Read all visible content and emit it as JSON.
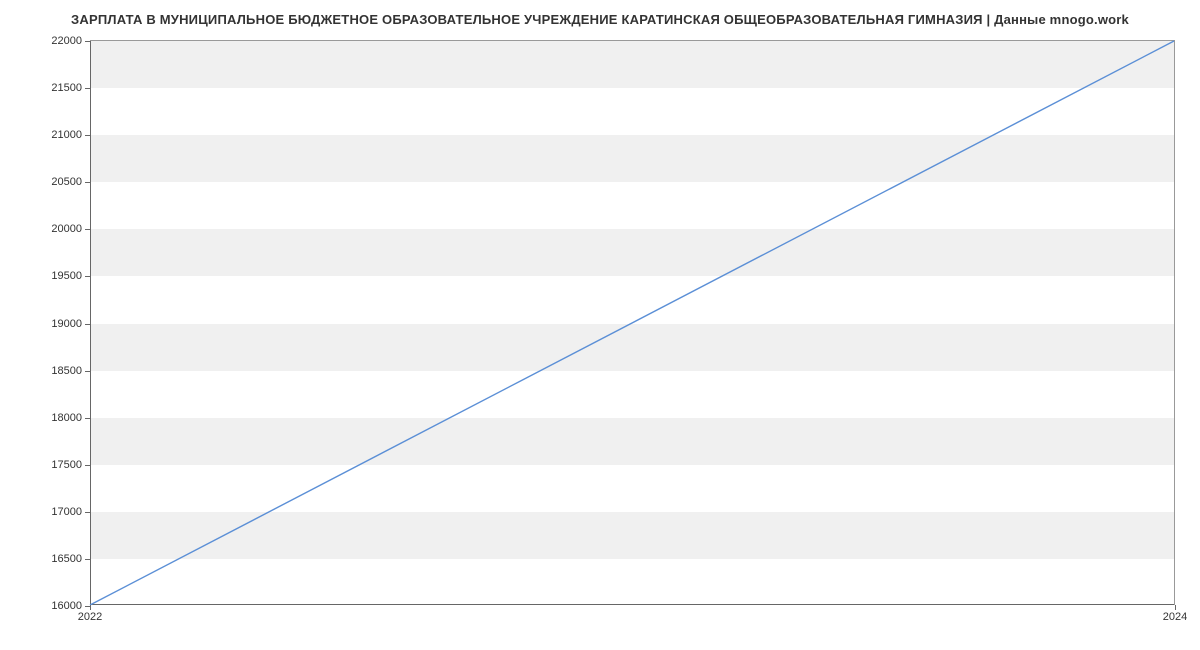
{
  "chart_data": {
    "type": "line",
    "title": "ЗАРПЛАТА В МУНИЦИПАЛЬНОЕ БЮДЖЕТНОЕ ОБРАЗОВАТЕЛЬНОЕ УЧРЕЖДЕНИЕ КАРАТИНСКАЯ ОБЩЕОБРАЗОВАТЕЛЬНАЯ ГИМНАЗИЯ | Данные mnogo.work",
    "x": [
      2022,
      2024
    ],
    "values": [
      16000,
      22000
    ],
    "xlabel": "",
    "ylabel": "",
    "xlim": [
      2022,
      2024
    ],
    "ylim": [
      16000,
      22000
    ],
    "x_ticks": [
      2022,
      2024
    ],
    "y_ticks": [
      16000,
      16500,
      17000,
      17500,
      18000,
      18500,
      19000,
      19500,
      20000,
      20500,
      21000,
      21500,
      22000
    ],
    "line_color": "#5b8fd6",
    "grid": true
  }
}
